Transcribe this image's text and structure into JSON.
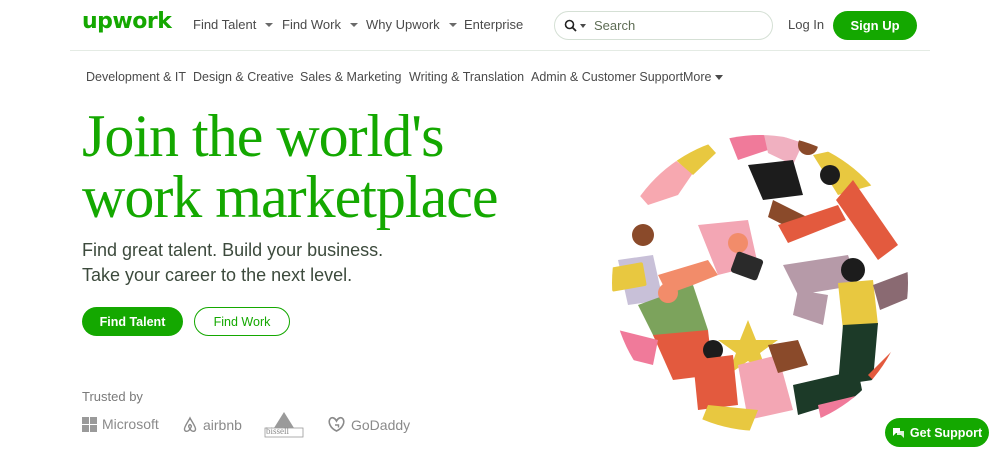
{
  "header": {
    "logo": "upwork",
    "nav": [
      {
        "label": "Find Talent",
        "dropdown": true
      },
      {
        "label": "Find Work",
        "dropdown": true
      },
      {
        "label": "Why Upwork",
        "dropdown": true
      },
      {
        "label": "Enterprise",
        "dropdown": false
      }
    ],
    "search_placeholder": "Search",
    "login": "Log In",
    "signup": "Sign Up"
  },
  "categories": [
    "Development & IT",
    "Design & Creative",
    "Sales & Marketing",
    "Writing & Translation",
    "Admin & Customer Support"
  ],
  "categories_more": "More",
  "hero": {
    "title_line1": "Join the world's",
    "title_line2": "work marketplace",
    "subtitle_line1": "Find great talent. Build your business.",
    "subtitle_line2": "Take your career to the next level.",
    "primary_button": "Find Talent",
    "secondary_button": "Find Work"
  },
  "trusted": {
    "label": "Trusted by",
    "brands": [
      "Microsoft",
      "airbnb",
      "Bissell",
      "GoDaddy"
    ]
  },
  "support_button": "Get Support",
  "colors": {
    "brand_green": "#14a800",
    "text_dark": "#001e00"
  },
  "icons": [
    "search-icon",
    "chevron-down-icon",
    "microsoft-logo-icon",
    "airbnb-logo-icon",
    "bissell-logo-icon",
    "godaddy-logo-icon",
    "chat-icon"
  ]
}
